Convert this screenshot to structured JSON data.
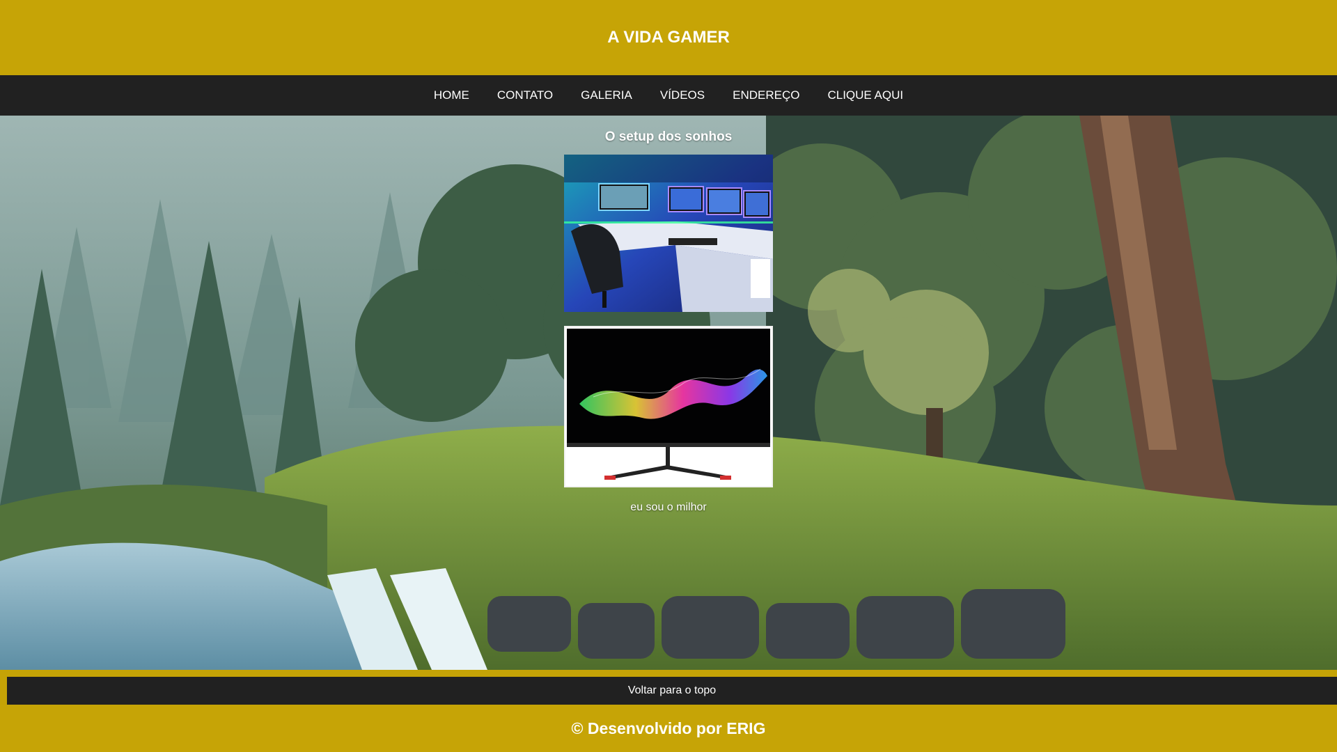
{
  "header": {
    "title": "A VIDA GAMER"
  },
  "nav": {
    "items": [
      {
        "label": "HOME"
      },
      {
        "label": "CONTATO"
      },
      {
        "label": "GALERIA"
      },
      {
        "label": "VÍDEOS"
      },
      {
        "label": "ENDEREÇO"
      },
      {
        "label": "CLIQUE AQUI"
      }
    ]
  },
  "main": {
    "section_title": "O setup dos sonhos",
    "caption": "eu sou o milhor"
  },
  "back_to_top": {
    "label": "Voltar para o topo"
  },
  "footer": {
    "text": "© Desenvolvido por ERIG"
  },
  "colors": {
    "header_bg": "#c6a406",
    "nav_bg": "#212121",
    "text": "#ffffff"
  }
}
